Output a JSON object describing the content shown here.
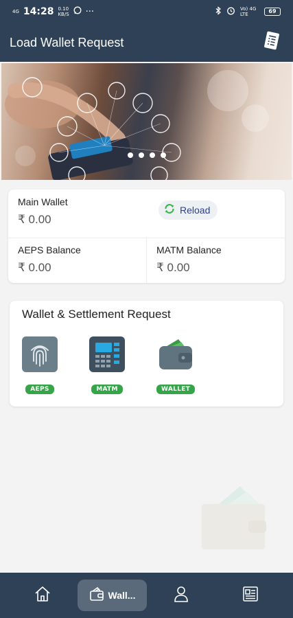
{
  "status_bar": {
    "time": "14:28",
    "net_speed_top": "0.10",
    "net_speed_bottom": "KB/S",
    "network_left": "4G",
    "network_right": "Vo) 4G LTE",
    "battery": "69"
  },
  "app_bar": {
    "title": "Load Wallet Request",
    "action_icon": "document-list-icon"
  },
  "banner": {
    "slide_count": 4,
    "active_slide": 1
  },
  "wallet_card": {
    "main_wallet": {
      "label": "Main Wallet",
      "amount": "₹ 0.00"
    },
    "reload": {
      "label": "Reload",
      "icon": "refresh-icon",
      "color": "#2d3f88"
    },
    "aeps": {
      "label": "AEPS Balance",
      "amount": "₹ 0.00"
    },
    "matm": {
      "label": "MATM Balance",
      "amount": "₹ 0.00"
    }
  },
  "settlement": {
    "title": "Wallet & Settlement Request",
    "items": [
      {
        "label": "AEPS",
        "icon": "fingerprint-icon"
      },
      {
        "label": "MATM",
        "icon": "card-machine-icon"
      },
      {
        "label": "WALLET",
        "icon": "wallet-icon"
      }
    ]
  },
  "bottom_nav": {
    "items": [
      {
        "icon": "home-icon"
      },
      {
        "icon": "wallet-icon",
        "label": "Wall..."
      },
      {
        "icon": "user-icon"
      },
      {
        "icon": "document-list-icon"
      }
    ]
  },
  "colors": {
    "primary": "#2e4157",
    "badge": "#36a54a",
    "reload_text": "#2d3f88",
    "background": "#f3f3f3"
  }
}
